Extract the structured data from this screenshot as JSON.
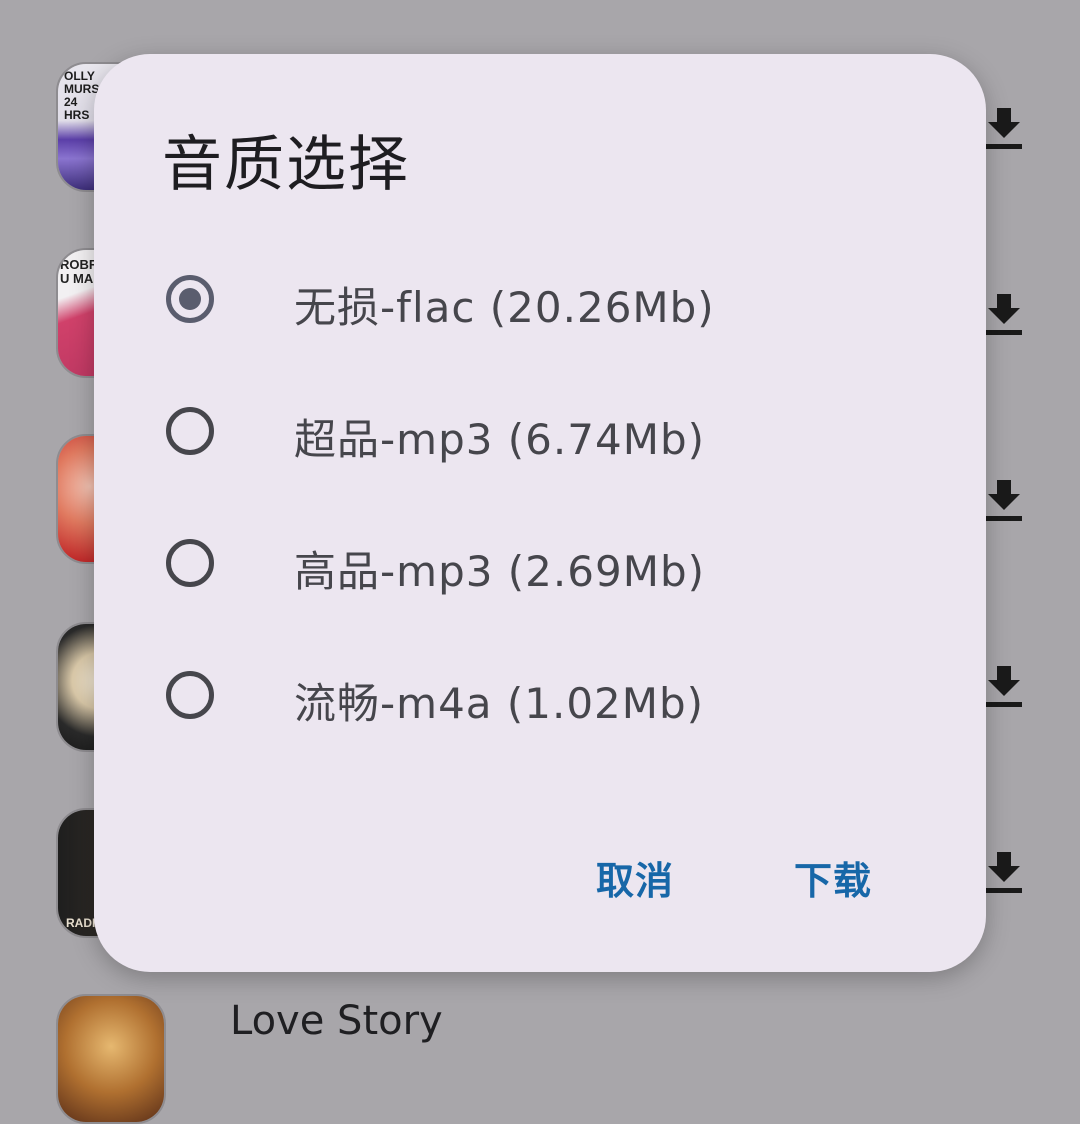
{
  "background": {
    "visible_song_title": "Love Story",
    "covers": [
      {
        "name": "album-cover-olly-murs",
        "text": "OLLY MURS 24 HRS",
        "colors": [
          "#e8e6ee",
          "#6a4fb0"
        ]
      },
      {
        "name": "album-cover-2",
        "text": "ROBRU MAR",
        "colors": [
          "#d0416a",
          "#f1f1f1"
        ]
      },
      {
        "name": "album-cover-3",
        "text": "",
        "colors": [
          "#d13330",
          "#f0b0a0"
        ]
      },
      {
        "name": "album-cover-4",
        "text": "",
        "colors": [
          "#1c1c1c",
          "#e8e0d0"
        ]
      },
      {
        "name": "album-cover-5",
        "text": "RADIO",
        "colors": [
          "#1f1f1f",
          "#c9a070"
        ]
      },
      {
        "name": "album-cover-6",
        "text": "",
        "colors": [
          "#c89040",
          "#6a3a20"
        ]
      }
    ],
    "download_icon": "download-icon"
  },
  "dialog": {
    "title": "音质选择",
    "options": [
      {
        "label": "无损-flac (20.26Mb)",
        "selected": true
      },
      {
        "label": "超品-mp3 (6.74Mb)",
        "selected": false
      },
      {
        "label": "高品-mp3 (2.69Mb)",
        "selected": false
      },
      {
        "label": "流畅-m4a (1.02Mb)",
        "selected": false
      }
    ],
    "cancel_label": "取消",
    "confirm_label": "下载",
    "accent_color": "#1767a8"
  },
  "colors": {
    "scrim_background": "#a8a6aa",
    "dialog_surface": "#ece6f0",
    "radio_selected": "#5a5d6e"
  }
}
